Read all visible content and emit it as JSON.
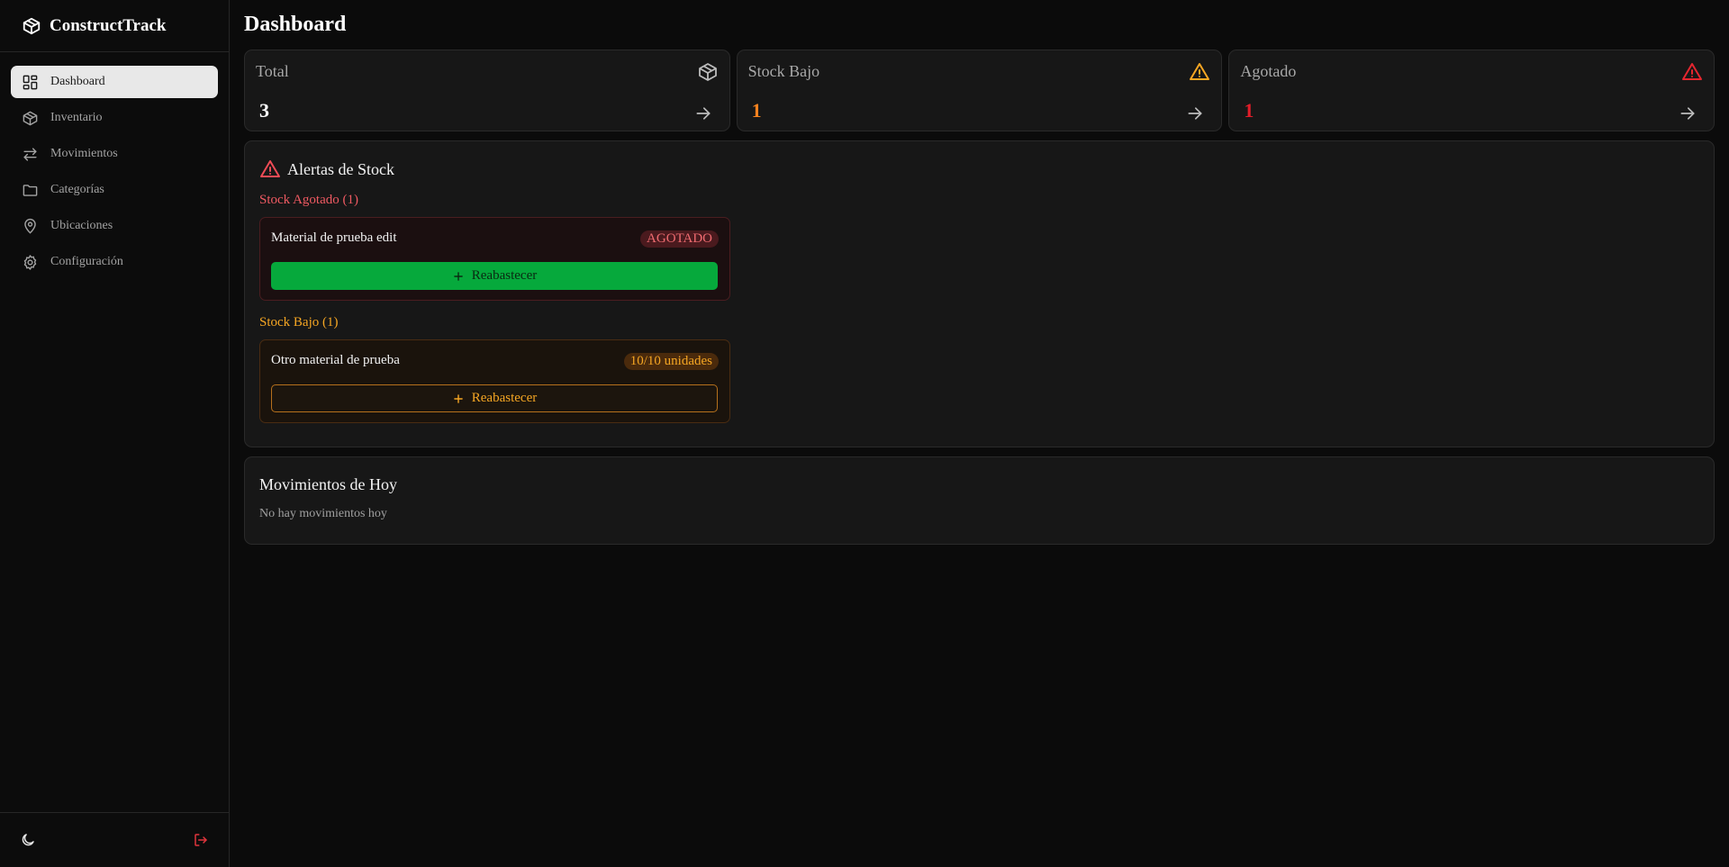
{
  "app": {
    "name": "ConstructTrack"
  },
  "sidebar": {
    "items": [
      {
        "label": "Dashboard",
        "icon": "layout-grid-icon",
        "active": true
      },
      {
        "label": "Inventario",
        "icon": "package-icon"
      },
      {
        "label": "Movimientos",
        "icon": "arrows-exchange-icon"
      },
      {
        "label": "Categorías",
        "icon": "folder-icon"
      },
      {
        "label": "Ubicaciones",
        "icon": "map-pin-icon"
      },
      {
        "label": "Configuración",
        "icon": "gear-icon"
      }
    ],
    "footer": {
      "theme_icon": "moon-icon",
      "logout_icon": "logout-icon"
    }
  },
  "page": {
    "title": "Dashboard"
  },
  "stats": [
    {
      "label": "Total",
      "value": "3",
      "icon": "package-icon",
      "color": "#ffffff"
    },
    {
      "label": "Stock Bajo",
      "value": "1",
      "icon": "warning-triangle-icon",
      "color": "#f5821f"
    },
    {
      "label": "Agotado",
      "value": "1",
      "icon": "warning-triangle-icon",
      "color": "#e11d29"
    }
  ],
  "alerts": {
    "title": "Alertas de Stock",
    "out_of_stock": {
      "heading": "Stock Agotado (1)",
      "items": [
        {
          "name": "Material de prueba edit",
          "badge": "AGOTADO",
          "action": "Reabastecer"
        }
      ]
    },
    "low_stock": {
      "heading": "Stock Bajo (1)",
      "items": [
        {
          "name": "Otro material de prueba",
          "badge": "10/10 unidades",
          "action": "Reabastecer"
        }
      ]
    }
  },
  "movements": {
    "title": "Movimientos de Hoy",
    "empty": "No hay movimientos hoy"
  },
  "colors": {
    "accent_green": "#06a93c",
    "warning_orange": "#f5a623",
    "danger_red": "#ef6b70"
  }
}
